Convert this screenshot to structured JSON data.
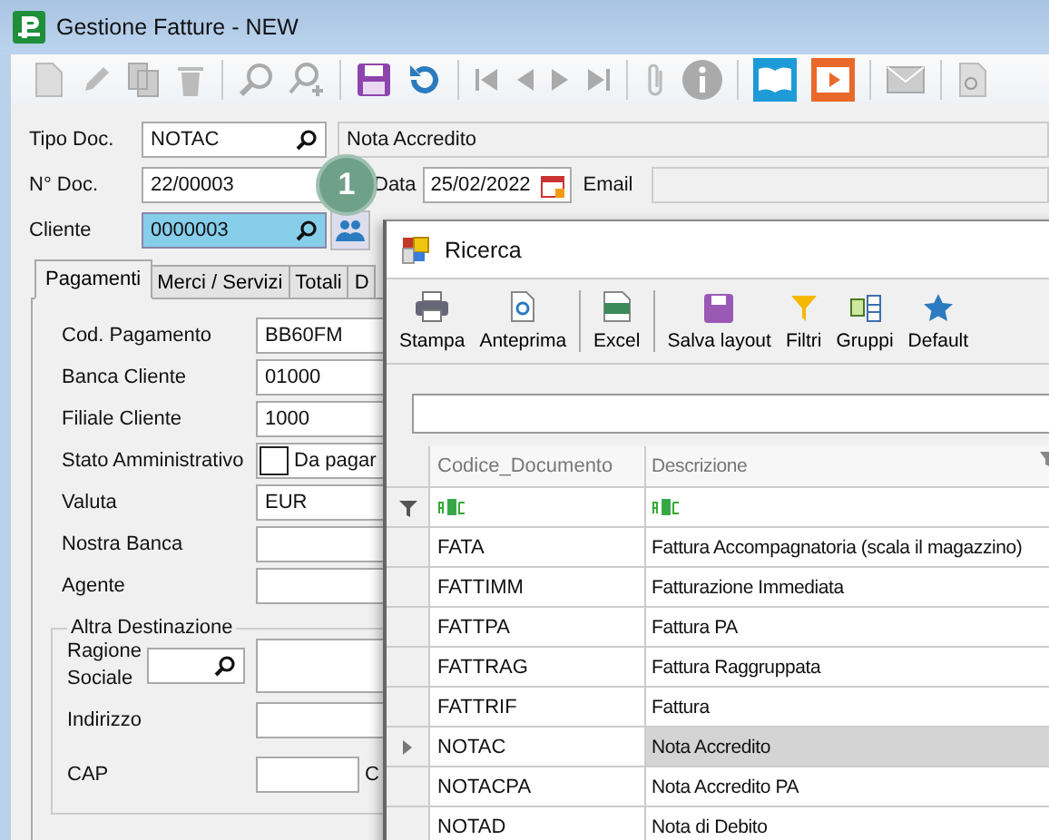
{
  "window": {
    "title": "Gestione Fatture - NEW"
  },
  "header": {
    "tipo_doc": {
      "label": "Tipo Doc.",
      "value": "NOTAC",
      "description": "Nota Accredito"
    },
    "n_doc": {
      "label": "N° Doc.",
      "value": "22/00003"
    },
    "step_badge": "1",
    "data": {
      "label": "Data",
      "value": "25/02/2022"
    },
    "email": {
      "label": "Email"
    },
    "cliente": {
      "label": "Cliente",
      "value": "0000003"
    }
  },
  "tabs": [
    {
      "label": "Pagamenti",
      "selected": true
    },
    {
      "label": "Merci / Servizi",
      "selected": false
    },
    {
      "label": "Totali",
      "selected": false
    },
    {
      "label": "D",
      "selected": false
    }
  ],
  "payment_fields": [
    {
      "kind": "text",
      "label": "Cod. Pagamento",
      "value": "BB60FM"
    },
    {
      "kind": "text",
      "label": "Banca Cliente",
      "value": "01000"
    },
    {
      "kind": "text",
      "label": "Filiale Cliente",
      "value": "1000"
    },
    {
      "kind": "checkbox",
      "label": "Stato Amministrativo",
      "checked": false,
      "option": "Da pagar"
    },
    {
      "kind": "text",
      "label": "Valuta",
      "value": "EUR"
    },
    {
      "kind": "text",
      "label": "Nostra Banca"
    },
    {
      "kind": "text",
      "label": "Agente"
    }
  ],
  "altra_destinazione": {
    "title": "Altra Destinazione",
    "ragione_sociale": "Ragione Sociale",
    "indirizzo": "Indirizzo",
    "cap": "CAP",
    "column_3": "C"
  },
  "dialog": {
    "title": "Ricerca",
    "toolbar": [
      {
        "kind": "print",
        "label": "Stampa"
      },
      {
        "kind": "preview",
        "label": "Anteprima"
      },
      {
        "kind": "excel",
        "label": "Excel"
      },
      {
        "kind": "save",
        "label": "Salva layout"
      },
      {
        "kind": "filter",
        "label": "Filtri"
      },
      {
        "kind": "groups",
        "label": "Gruppi"
      },
      {
        "kind": "star",
        "label": "Default"
      }
    ],
    "columns": [
      "Codice_Documento",
      "Descrizione"
    ],
    "rows": [
      {
        "code": "FATA",
        "description": "Fattura Accompagnatoria (scala il magazzino)",
        "selected": false
      },
      {
        "code": "FATTIMM",
        "description": "Fatturazione Immediata",
        "selected": false
      },
      {
        "code": "FATTPA",
        "description": "Fattura PA",
        "selected": false
      },
      {
        "code": "FATTRAG",
        "description": "Fattura Raggruppata",
        "selected": false
      },
      {
        "code": "FATTRIF",
        "description": "Fattura",
        "selected": false
      },
      {
        "code": "NOTAC",
        "description": "Nota Accredito",
        "selected": true
      },
      {
        "code": "NOTACPA",
        "description": "Nota Accredito PA",
        "selected": false
      },
      {
        "code": "NOTAD",
        "description": "Nota di Debito",
        "selected": false
      }
    ]
  }
}
